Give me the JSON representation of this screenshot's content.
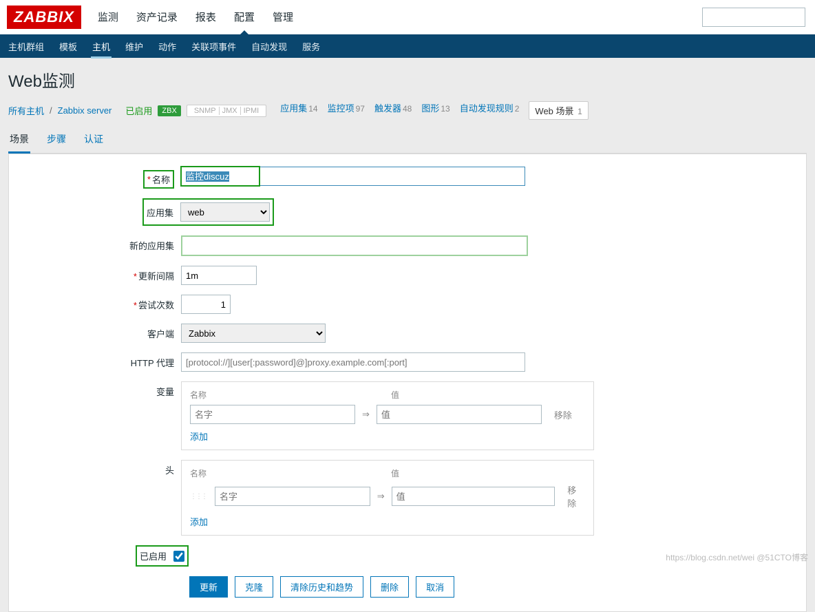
{
  "header": {
    "logo": "ZABBIX",
    "topnav": [
      "监测",
      "资产记录",
      "报表",
      "配置",
      "管理"
    ],
    "topnav_active": "配置",
    "subnav": [
      "主机群组",
      "模板",
      "主机",
      "维护",
      "动作",
      "关联项事件",
      "自动发现",
      "服务"
    ],
    "subnav_active": "主机"
  },
  "page_title": "Web监测",
  "breadcrumb": {
    "all_hosts": "所有主机",
    "server": "Zabbix server",
    "enabled": "已启用",
    "zbx": "ZBX",
    "indicators": [
      "SNMP",
      "JMX",
      "IPMI"
    ],
    "links": [
      {
        "label": "应用集",
        "count": "14"
      },
      {
        "label": "监控项",
        "count": "97"
      },
      {
        "label": "触发器",
        "count": "48"
      },
      {
        "label": "图形",
        "count": "13"
      },
      {
        "label": "自动发现规则",
        "count": "2"
      }
    ],
    "web_scenario": {
      "label": "Web 场景",
      "count": "1"
    }
  },
  "tabs": [
    "场景",
    "步骤",
    "认证"
  ],
  "tabs_active": "场景",
  "form": {
    "name_label": "名称",
    "name_value": "监控discuz",
    "app_label": "应用集",
    "app_value": "web",
    "newapp_label": "新的应用集",
    "newapp_value": "",
    "interval_label": "更新间隔",
    "interval_value": "1m",
    "retries_label": "尝试次数",
    "retries_value": "1",
    "agent_label": "客户端",
    "agent_value": "Zabbix",
    "proxy_label": "HTTP 代理",
    "proxy_placeholder": "[protocol://][user[:password]@]proxy.example.com[:port]",
    "vars_label": "变量",
    "headers_label": "头",
    "col_name": "名称",
    "col_value": "值",
    "ph_name": "名字",
    "ph_value": "值",
    "remove": "移除",
    "add": "添加",
    "enabled_label": "已启用",
    "enabled_checked": true
  },
  "buttons": {
    "update": "更新",
    "clone": "克隆",
    "clear": "清除历史和趋势",
    "delete": "删除",
    "cancel": "取消"
  },
  "watermark": "https://blog.csdn.net/wei @51CTO博客"
}
